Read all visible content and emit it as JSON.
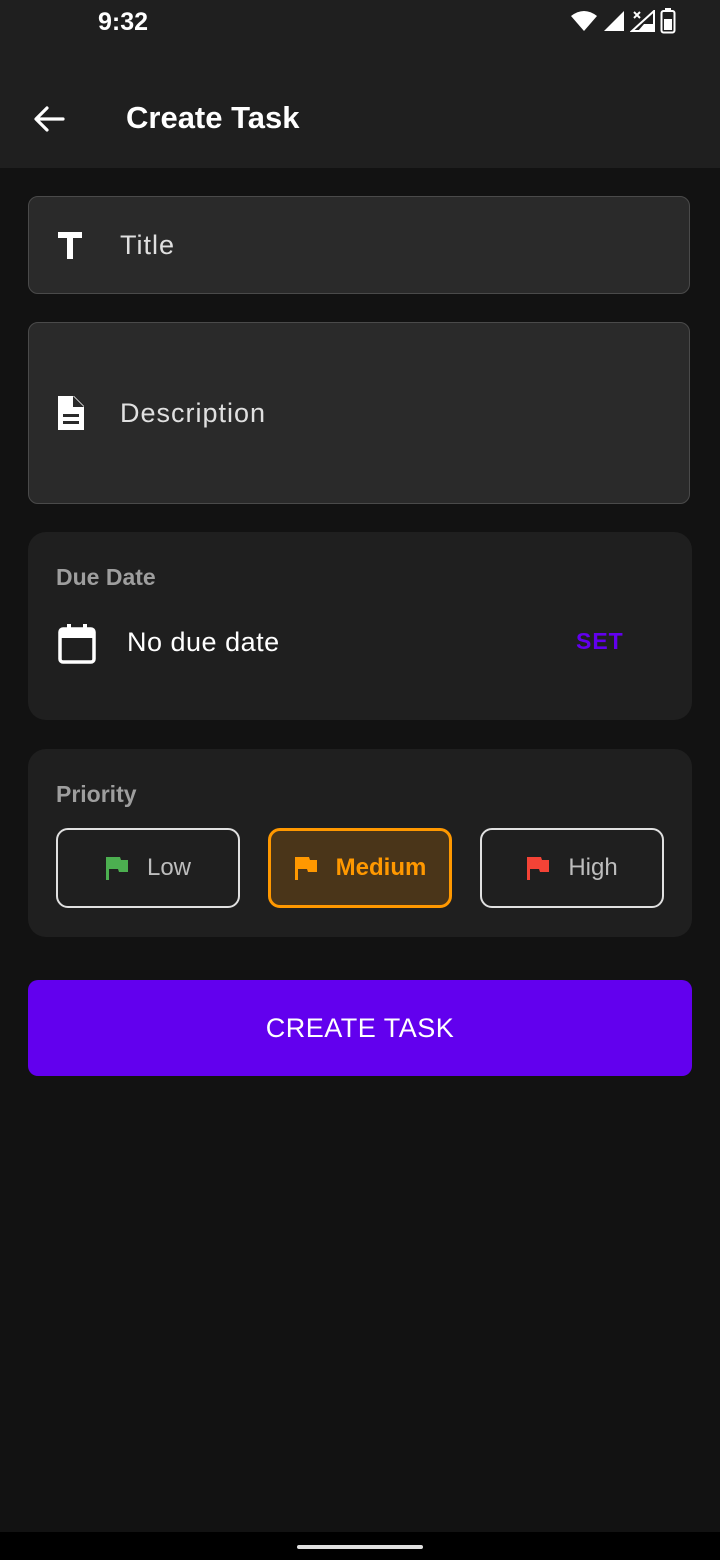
{
  "status_bar": {
    "time": "9:32",
    "icons": [
      "wifi-icon",
      "signal-icon",
      "signal-no-data-icon",
      "battery-icon"
    ]
  },
  "app_bar": {
    "title": "Create Task",
    "back_icon": "arrow-back-icon"
  },
  "form": {
    "title_field": {
      "placeholder": "Title",
      "icon": "text-format-icon"
    },
    "description_field": {
      "placeholder": "Description",
      "icon": "description-icon"
    }
  },
  "due_date": {
    "label": "Due Date",
    "value": "No due date",
    "icon": "calendar-icon",
    "action": "SET"
  },
  "priority": {
    "label": "Priority",
    "options": [
      {
        "label": "Low",
        "color": "#4caf50",
        "selected": false
      },
      {
        "label": "Medium",
        "color": "#ff9800",
        "selected": true
      },
      {
        "label": "High",
        "color": "#f44336",
        "selected": false
      }
    ]
  },
  "actions": {
    "create_label": "CREATE TASK"
  },
  "colors": {
    "accent": "#6200ee",
    "background": "#121212",
    "surface": "#1f1f1f",
    "selected_priority": "#ff9800"
  }
}
